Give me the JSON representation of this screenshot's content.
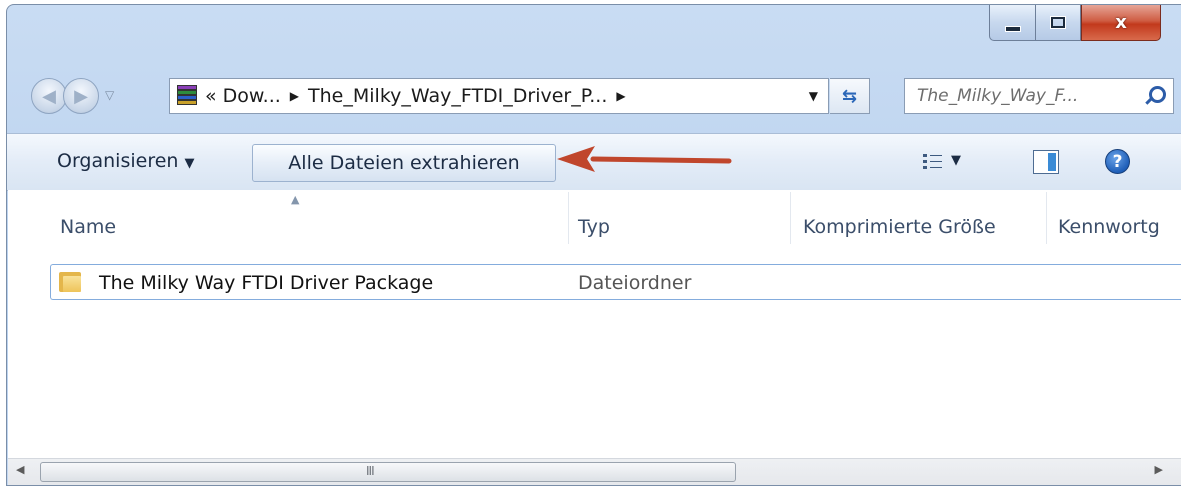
{
  "window": {
    "caption": {
      "minimize_glyph": "",
      "maximize_glyph": "",
      "close_glyph": "x"
    }
  },
  "navigation": {
    "back_glyph": "◀",
    "forward_glyph": "▶",
    "history_dropdown_glyph": "▽"
  },
  "address_bar": {
    "overflow_chevron": "«",
    "crumbs": [
      "Dow...",
      "The_Milky_Way_FTDI_Driver_P..."
    ],
    "separator_glyph": "▶",
    "dropdown_glyph": "▼",
    "refresh_glyph": "⇆"
  },
  "search": {
    "placeholder": "The_Milky_Way_F..."
  },
  "command_bar": {
    "organize_label": "Organisieren",
    "organize_arrow": "▼",
    "extract_label": "Alle Dateien extrahieren",
    "view_dropdown_glyph": "▼",
    "help_glyph": "?"
  },
  "columns": [
    "Name",
    "Typ",
    "Komprimierte Größe",
    "Kennwortg"
  ],
  "sort_indicator": "▲",
  "files": [
    {
      "name": "The Milky Way FTDI Driver Package",
      "type": "Dateiordner"
    }
  ],
  "scrollbar": {
    "left_glyph": "◀",
    "right_glyph": "▶",
    "grip_glyph": "III"
  },
  "colors": {
    "annotation_arrow": "#c0462c",
    "frame": "#c3d7f0",
    "selection_border": "#84acdd"
  }
}
